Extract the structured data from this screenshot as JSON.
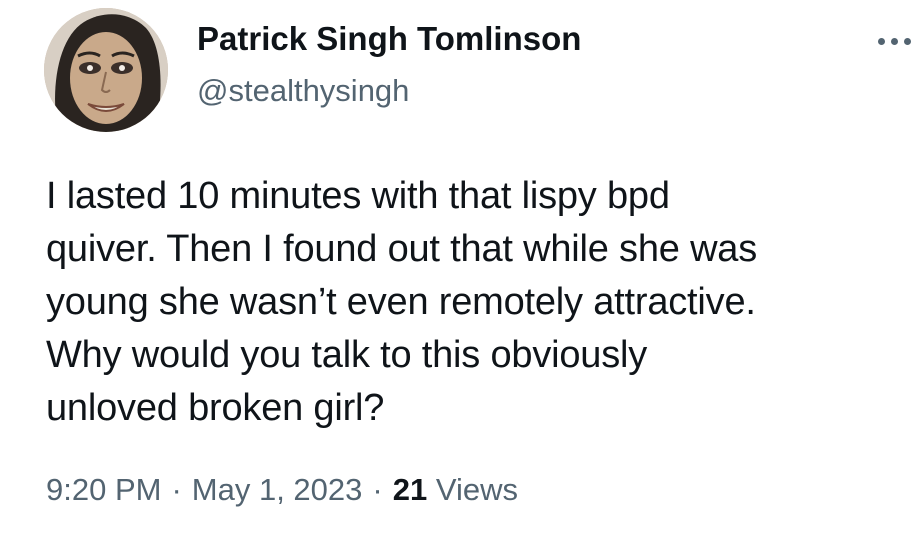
{
  "author": {
    "display_name": "Patrick Singh Tomlinson",
    "handle": "@stealthysingh",
    "avatar_icon": "profile-photo"
  },
  "more_icon": "more-horizontal-icon",
  "tweet": {
    "text": "I lasted 10 minutes with that lispy bpd\nquiver. Then I found out that while she was\nyoung she wasn’t even remotely attractive.\nWhy would you talk to this obviously\nunloved broken girl?",
    "time": "9:20 PM",
    "separator": "·",
    "date": "May 1, 2023",
    "views_count": "21",
    "views_label": "Views"
  },
  "colors": {
    "text_primary": "#0f1419",
    "text_secondary": "#536471",
    "background": "#ffffff"
  }
}
